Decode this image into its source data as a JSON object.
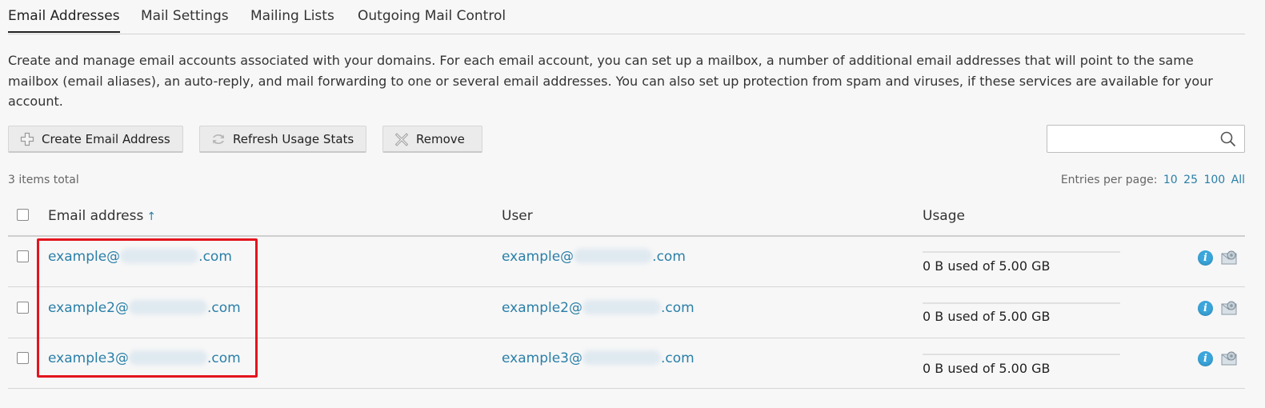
{
  "tabs": [
    {
      "label": "Email Addresses"
    },
    {
      "label": "Mail Settings"
    },
    {
      "label": "Mailing Lists"
    },
    {
      "label": "Outgoing Mail Control"
    }
  ],
  "description": "Create and manage email accounts associated with your domains. For each email account, you can set up a mailbox, a number of additional email addresses that will point to the same mailbox (email aliases), an auto-reply, and mail forwarding to one or several email addresses. You can also set up protection from spam and viruses, if these services are available for your account.",
  "toolbar": {
    "create_label": "Create Email Address",
    "refresh_label": "Refresh Usage Stats",
    "remove_label": "Remove"
  },
  "search": {
    "value": ""
  },
  "list": {
    "total_text": "3 items total",
    "per_page_label": "Entries per page:",
    "per_page_options": [
      "10",
      "25",
      "100",
      "All"
    ]
  },
  "columns": {
    "email": "Email address",
    "user": "User",
    "usage": "Usage",
    "sort_indicator": "↑"
  },
  "rows": [
    {
      "email_prefix": "example@",
      "email_suffix": ".com",
      "user_prefix": "example@",
      "user_suffix": ".com",
      "usage": "0 B used of 5.00 GB",
      "usage_fraction": 0
    },
    {
      "email_prefix": "example2@",
      "email_suffix": ".com",
      "user_prefix": "example2@",
      "user_suffix": ".com",
      "usage": "0 B used of 5.00 GB",
      "usage_fraction": 0
    },
    {
      "email_prefix": "example3@",
      "email_suffix": ".com",
      "user_prefix": "example3@",
      "user_suffix": ".com",
      "usage": "0 B used of 5.00 GB",
      "usage_fraction": 0
    }
  ],
  "icons": {
    "info": "info-icon",
    "mail": "mail-settings-icon",
    "create": "plus-icon",
    "refresh": "refresh-icon",
    "remove": "remove-icon",
    "search": "search-icon"
  },
  "colors": {
    "link": "#2a7fa8",
    "highlight": "#e3141e",
    "info": "#3aa6dc"
  }
}
